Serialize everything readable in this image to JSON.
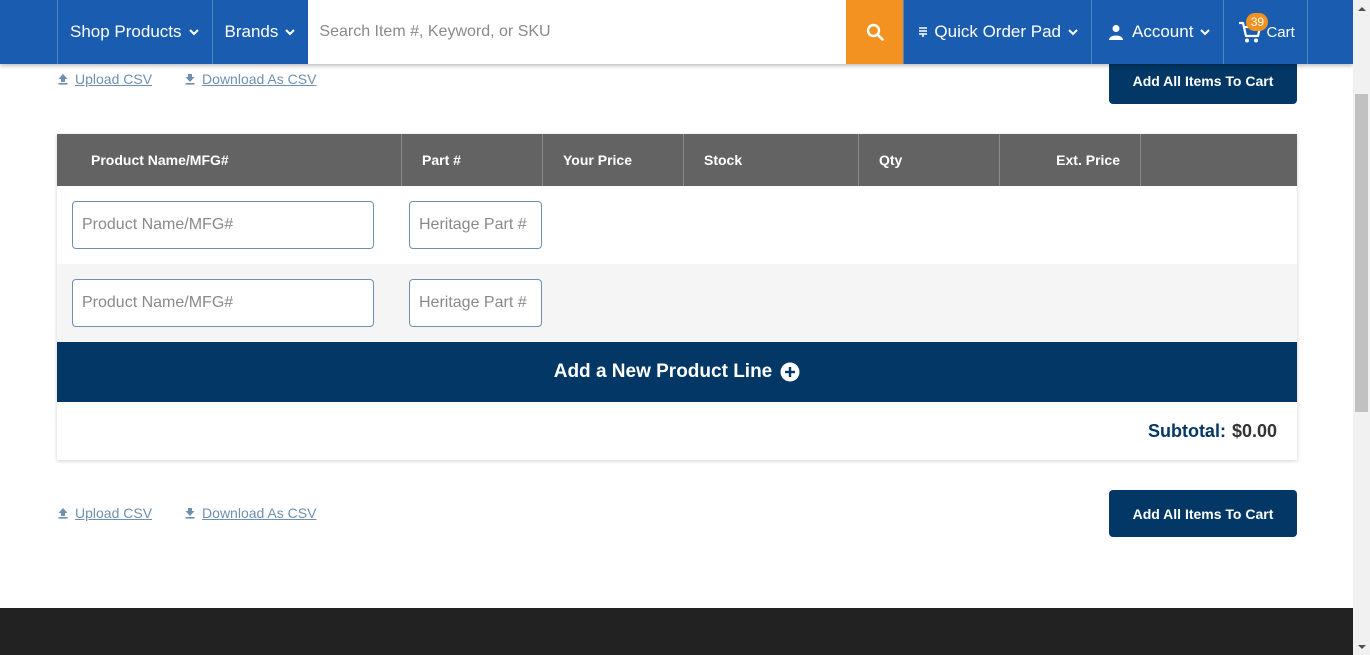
{
  "header": {
    "shop_products": "Shop Products",
    "brands": "Brands",
    "search_placeholder": "Search Item #, Keyword, or SKU",
    "quick_order_pad": "Quick Order Pad",
    "account": "Account",
    "cart_label": "Cart",
    "cart_count": "39"
  },
  "csv_top": {
    "upload": "Upload CSV",
    "download": "Download As CSV",
    "add_all": "Add All Items To Cart"
  },
  "table": {
    "headers": [
      "Product Name/MFG#",
      "Part #",
      "Your Price",
      "Stock",
      "Qty",
      "Ext. Price"
    ],
    "rows": [
      {
        "name_placeholder": "Product Name/MFG#",
        "part_placeholder": "Heritage Part #"
      },
      {
        "name_placeholder": "Product Name/MFG#",
        "part_placeholder": "Heritage Part #"
      }
    ],
    "add_line": "Add a New Product Line",
    "subtotal_label": "Subtotal:",
    "subtotal_value": "$0.00"
  },
  "csv_bottom": {
    "upload": "Upload CSV",
    "download": "Download As CSV",
    "add_all": "Add All Items To Cart"
  },
  "colors": {
    "header_blue": "#1a5cb0",
    "accent_orange": "#f39221",
    "navy": "#023766",
    "table_header_gray": "#636363",
    "footer_dark": "#222222"
  }
}
